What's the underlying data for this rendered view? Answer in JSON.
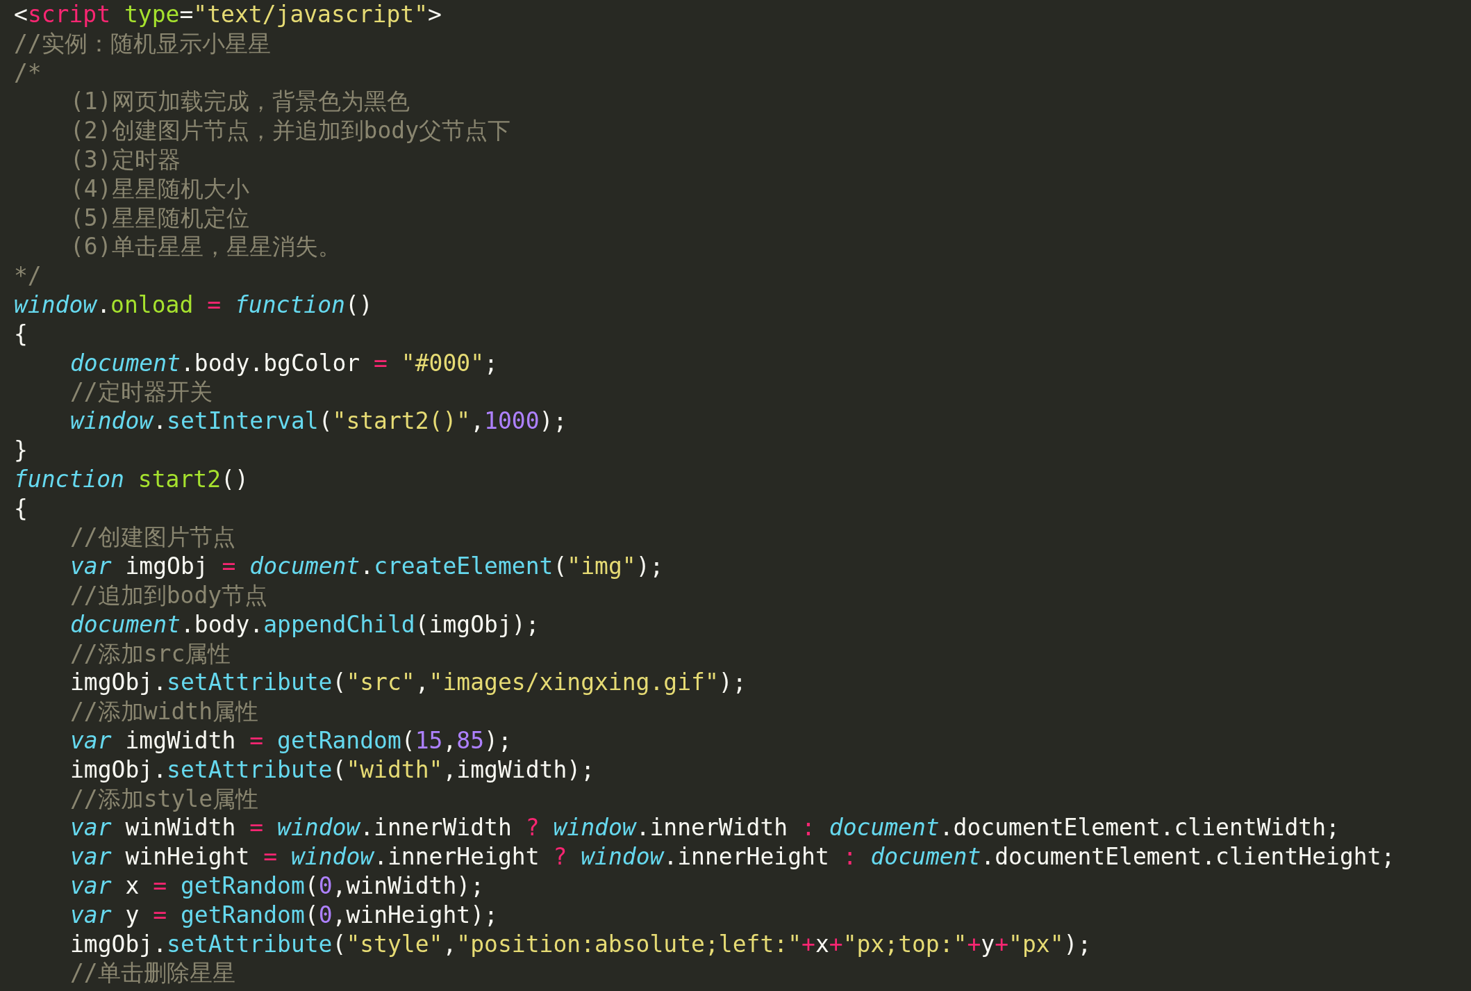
{
  "editor": {
    "lines": [
      {
        "tokens": [
          {
            "kind": "plain",
            "text": "<"
          },
          {
            "kind": "tag",
            "text": "script"
          },
          {
            "kind": "attr",
            "text": " type"
          },
          {
            "kind": "plain",
            "text": "="
          },
          {
            "kind": "string",
            "text": "\"text/javascript\""
          },
          {
            "kind": "plain",
            "text": ">"
          }
        ]
      },
      {
        "tokens": [
          {
            "kind": "comment",
            "text": "//实例：随机显示小星星"
          }
        ]
      },
      {
        "tokens": [
          {
            "kind": "comment",
            "text": "/*"
          }
        ],
        "children": [
          {
            "tokens": [
              {
                "kind": "comment",
                "text": "(1)网页加载完成，背景色为黑色"
              }
            ]
          },
          {
            "tokens": [
              {
                "kind": "comment",
                "text": "(2)创建图片节点，并追加到body父节点下"
              }
            ]
          },
          {
            "tokens": [
              {
                "kind": "comment",
                "text": "(3)定时器"
              }
            ]
          },
          {
            "tokens": [
              {
                "kind": "comment",
                "text": "(4)星星随机大小"
              }
            ]
          },
          {
            "tokens": [
              {
                "kind": "comment",
                "text": "(5)星星随机定位"
              }
            ]
          },
          {
            "tokens": [
              {
                "kind": "comment",
                "text": "(6)单击星星，星星消失。"
              }
            ]
          }
        ]
      },
      {
        "tokens": [
          {
            "kind": "comment",
            "text": "*/"
          }
        ]
      },
      {
        "tokens": [
          {
            "kind": "object",
            "text": "window"
          },
          {
            "kind": "plain",
            "text": "."
          },
          {
            "kind": "name",
            "text": "onload"
          },
          {
            "kind": "operator",
            "text": " = "
          },
          {
            "kind": "keyword",
            "text": "function"
          },
          {
            "kind": "plain",
            "text": "()"
          }
        ]
      },
      {
        "tokens": [
          {
            "kind": "plain",
            "text": "{"
          }
        ],
        "children": [
          {
            "tokens": [
              {
                "kind": "object",
                "text": "document"
              },
              {
                "kind": "plain",
                "text": ".body.bgColor"
              },
              {
                "kind": "operator",
                "text": " = "
              },
              {
                "kind": "string",
                "text": "\"#000\""
              },
              {
                "kind": "plain",
                "text": ";"
              }
            ]
          },
          {
            "tokens": [
              {
                "kind": "comment",
                "text": "//定时器开关"
              }
            ]
          },
          {
            "tokens": [
              {
                "kind": "object",
                "text": "window"
              },
              {
                "kind": "plain",
                "text": "."
              },
              {
                "kind": "call",
                "text": "setInterval"
              },
              {
                "kind": "plain",
                "text": "("
              },
              {
                "kind": "string",
                "text": "\"start2()\""
              },
              {
                "kind": "plain",
                "text": ","
              },
              {
                "kind": "number",
                "text": "1000"
              },
              {
                "kind": "plain",
                "text": ");"
              }
            ]
          }
        ]
      },
      {
        "tokens": [
          {
            "kind": "plain",
            "text": "}"
          }
        ]
      },
      {
        "tokens": [
          {
            "kind": "keyword",
            "text": "function"
          },
          {
            "kind": "name",
            "text": " start2"
          },
          {
            "kind": "plain",
            "text": "()"
          }
        ]
      },
      {
        "tokens": [
          {
            "kind": "plain",
            "text": "{"
          }
        ],
        "children": [
          {
            "tokens": [
              {
                "kind": "comment",
                "text": "//创建图片节点"
              }
            ]
          },
          {
            "tokens": [
              {
                "kind": "keyword",
                "text": "var"
              },
              {
                "kind": "plain",
                "text": " imgObj"
              },
              {
                "kind": "operator",
                "text": " = "
              },
              {
                "kind": "object",
                "text": "document"
              },
              {
                "kind": "plain",
                "text": "."
              },
              {
                "kind": "call",
                "text": "createElement"
              },
              {
                "kind": "plain",
                "text": "("
              },
              {
                "kind": "string",
                "text": "\"img\""
              },
              {
                "kind": "plain",
                "text": ");"
              }
            ]
          },
          {
            "tokens": [
              {
                "kind": "comment",
                "text": "//追加到body节点"
              }
            ]
          },
          {
            "tokens": [
              {
                "kind": "object",
                "text": "document"
              },
              {
                "kind": "plain",
                "text": ".body."
              },
              {
                "kind": "call",
                "text": "appendChild"
              },
              {
                "kind": "plain",
                "text": "(imgObj);"
              }
            ]
          },
          {
            "tokens": [
              {
                "kind": "comment",
                "text": "//添加src属性"
              }
            ]
          },
          {
            "tokens": [
              {
                "kind": "plain",
                "text": "imgObj."
              },
              {
                "kind": "call",
                "text": "setAttribute"
              },
              {
                "kind": "plain",
                "text": "("
              },
              {
                "kind": "string",
                "text": "\"src\""
              },
              {
                "kind": "plain",
                "text": ","
              },
              {
                "kind": "string",
                "text": "\"images/xingxing.gif\""
              },
              {
                "kind": "plain",
                "text": ");"
              }
            ]
          },
          {
            "tokens": [
              {
                "kind": "comment",
                "text": "//添加width属性"
              }
            ]
          },
          {
            "tokens": [
              {
                "kind": "keyword",
                "text": "var"
              },
              {
                "kind": "plain",
                "text": " imgWidth"
              },
              {
                "kind": "operator",
                "text": " = "
              },
              {
                "kind": "call",
                "text": "getRandom"
              },
              {
                "kind": "plain",
                "text": "("
              },
              {
                "kind": "number",
                "text": "15"
              },
              {
                "kind": "plain",
                "text": ","
              },
              {
                "kind": "number",
                "text": "85"
              },
              {
                "kind": "plain",
                "text": ");"
              }
            ]
          },
          {
            "tokens": [
              {
                "kind": "plain",
                "text": "imgObj."
              },
              {
                "kind": "call",
                "text": "setAttribute"
              },
              {
                "kind": "plain",
                "text": "("
              },
              {
                "kind": "string",
                "text": "\"width\""
              },
              {
                "kind": "plain",
                "text": ",imgWidth);"
              }
            ]
          },
          {
            "tokens": [
              {
                "kind": "comment",
                "text": "//添加style属性"
              }
            ]
          },
          {
            "tokens": [
              {
                "kind": "keyword",
                "text": "var"
              },
              {
                "kind": "plain",
                "text": " winWidth"
              },
              {
                "kind": "operator",
                "text": " = "
              },
              {
                "kind": "object",
                "text": "window"
              },
              {
                "kind": "plain",
                "text": ".innerWidth"
              },
              {
                "kind": "operator",
                "text": " ? "
              },
              {
                "kind": "object",
                "text": "window"
              },
              {
                "kind": "plain",
                "text": ".innerWidth"
              },
              {
                "kind": "operator",
                "text": " : "
              },
              {
                "kind": "object",
                "text": "document"
              },
              {
                "kind": "plain",
                "text": ".documentElement.clientWidth;"
              }
            ]
          },
          {
            "tokens": [
              {
                "kind": "keyword",
                "text": "var"
              },
              {
                "kind": "plain",
                "text": " winHeight"
              },
              {
                "kind": "operator",
                "text": " = "
              },
              {
                "kind": "object",
                "text": "window"
              },
              {
                "kind": "plain",
                "text": ".innerHeight"
              },
              {
                "kind": "operator",
                "text": " ? "
              },
              {
                "kind": "object",
                "text": "window"
              },
              {
                "kind": "plain",
                "text": ".innerHeight"
              },
              {
                "kind": "operator",
                "text": " : "
              },
              {
                "kind": "object",
                "text": "document"
              },
              {
                "kind": "plain",
                "text": ".documentElement.clientHeight;"
              }
            ]
          },
          {
            "tokens": [
              {
                "kind": "keyword",
                "text": "var"
              },
              {
                "kind": "plain",
                "text": " x"
              },
              {
                "kind": "operator",
                "text": " = "
              },
              {
                "kind": "call",
                "text": "getRandom"
              },
              {
                "kind": "plain",
                "text": "("
              },
              {
                "kind": "number",
                "text": "0"
              },
              {
                "kind": "plain",
                "text": ",winWidth);"
              }
            ]
          },
          {
            "tokens": [
              {
                "kind": "keyword",
                "text": "var"
              },
              {
                "kind": "plain",
                "text": " y"
              },
              {
                "kind": "operator",
                "text": " = "
              },
              {
                "kind": "call",
                "text": "getRandom"
              },
              {
                "kind": "plain",
                "text": "("
              },
              {
                "kind": "number",
                "text": "0"
              },
              {
                "kind": "plain",
                "text": ",winHeight);"
              }
            ]
          },
          {
            "tokens": [
              {
                "kind": "plain",
                "text": "imgObj."
              },
              {
                "kind": "call",
                "text": "setAttribute"
              },
              {
                "kind": "plain",
                "text": "("
              },
              {
                "kind": "string",
                "text": "\"style\""
              },
              {
                "kind": "plain",
                "text": ","
              },
              {
                "kind": "string",
                "text": "\"position:absolute;left:\""
              },
              {
                "kind": "operator",
                "text": "+"
              },
              {
                "kind": "plain",
                "text": "x"
              },
              {
                "kind": "operator",
                "text": "+"
              },
              {
                "kind": "string",
                "text": "\"px;top:\""
              },
              {
                "kind": "operator",
                "text": "+"
              },
              {
                "kind": "plain",
                "text": "y"
              },
              {
                "kind": "operator",
                "text": "+"
              },
              {
                "kind": "string",
                "text": "\"px\""
              },
              {
                "kind": "plain",
                "text": ");"
              }
            ]
          },
          {
            "tokens": [
              {
                "kind": "comment",
                "text": "//单击删除星星"
              }
            ]
          }
        ]
      }
    ]
  }
}
